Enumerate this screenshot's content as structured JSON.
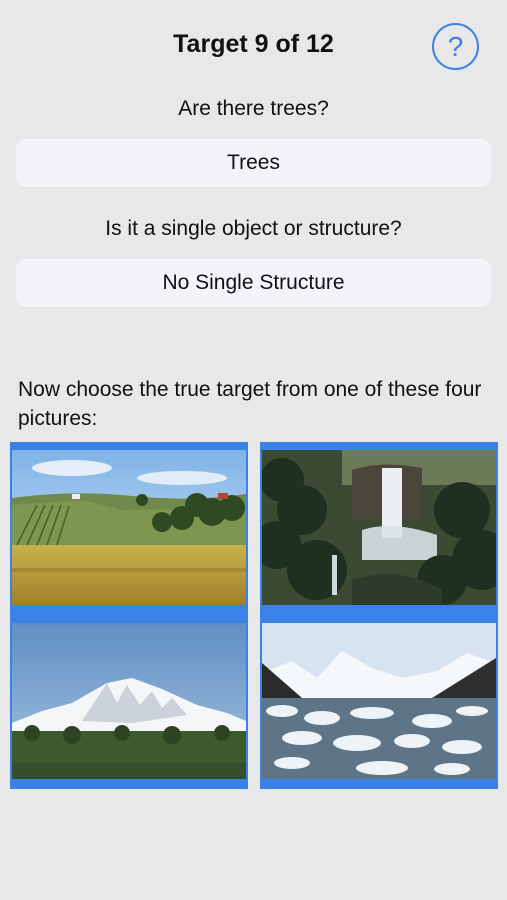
{
  "header": {
    "title": "Target 9 of 12",
    "help_icon": "question-circle-icon",
    "help_label": "?"
  },
  "questions": [
    {
      "prompt": "Are there trees?",
      "answer": "Trees"
    },
    {
      "prompt": "Is it a single object or structure?",
      "answer": "No Single Structure"
    }
  ],
  "choose_prompt": "Now choose the true target from one of these four pictures:",
  "accent_color": "#3b82e6",
  "pictures": [
    {
      "subject": "vineyard-hills-photo"
    },
    {
      "subject": "waterfall-photo"
    },
    {
      "subject": "snow-mountain-photo"
    },
    {
      "subject": "glacier-lake-photo"
    }
  ]
}
